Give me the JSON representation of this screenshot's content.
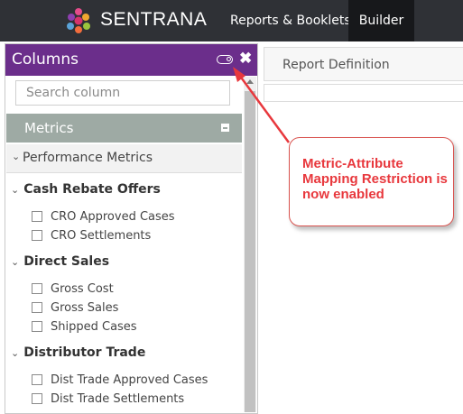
{
  "header": {
    "brand": "SENTRANA",
    "nav": [
      "Reports & Booklets",
      "Builder"
    ]
  },
  "columns_panel": {
    "title": "Columns",
    "search_placeholder": "Search column",
    "metrics_label": "Metrics",
    "performance_label": "Performance Metrics",
    "groups": [
      {
        "title": "Cash Rebate Offers",
        "items": [
          "CRO Approved Cases",
          "CRO Settlements"
        ]
      },
      {
        "title": "Direct Sales",
        "items": [
          "Gross Cost",
          "Gross Sales",
          "Shipped Cases"
        ]
      },
      {
        "title": "Distributor Trade",
        "items": [
          "Dist Trade Approved Cases",
          "Dist Trade Settlements"
        ]
      }
    ]
  },
  "report": {
    "tab_label": "Report Definition"
  },
  "callout": {
    "text": "Metric-Attribute Mapping Restriction is now enabled",
    "color": "#e8383d"
  },
  "colors": {
    "topbar": "#2f3136",
    "panel_header": "#6b2e8b",
    "metrics_bar": "#9eaaa4",
    "builder_active": "#17181b"
  }
}
